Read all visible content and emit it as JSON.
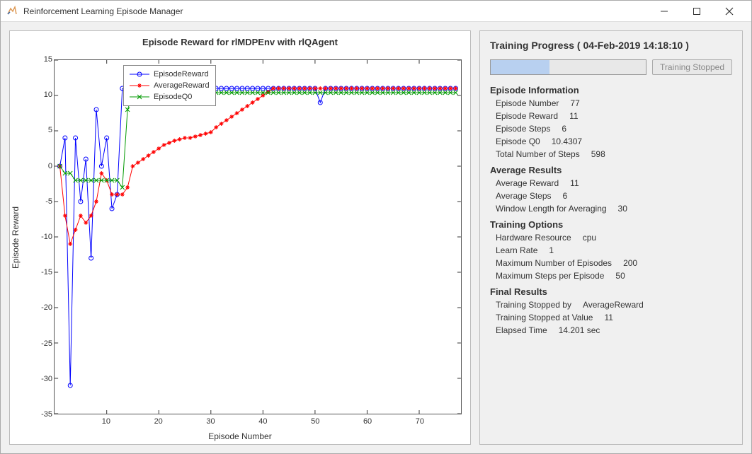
{
  "window": {
    "title": "Reinforcement Learning Episode Manager"
  },
  "plot": {
    "title": "Episode Reward for rlMDPEnv with rlQAgent",
    "xlabel": "Episode Number",
    "ylabel": "Episode Reward",
    "legend": {
      "s1": "EpisodeReward",
      "s2": "AverageReward",
      "s3": "EpisodeQ0"
    }
  },
  "side": {
    "title": "Training Progress ( 04-Feb-2019 14:18:10 )",
    "button": "Training Stopped",
    "sections": {
      "ep_info": "Episode Information",
      "avg": "Average Results",
      "opts": "Training Options",
      "final": "Final Results"
    },
    "ep": {
      "num_k": "Episode Number",
      "num_v": "77",
      "rew_k": "Episode Reward",
      "rew_v": "11",
      "steps_k": "Episode Steps",
      "steps_v": "6",
      "q0_k": "Episode Q0",
      "q0_v": "10.4307",
      "total_k": "Total Number of Steps",
      "total_v": "598"
    },
    "avg_r": {
      "rew_k": "Average Reward",
      "rew_v": "11",
      "steps_k": "Average Steps",
      "steps_v": "6",
      "win_k": "Window Length for Averaging",
      "win_v": "30"
    },
    "opts": {
      "hw_k": "Hardware Resource",
      "hw_v": "cpu",
      "lr_k": "Learn Rate",
      "lr_v": "1",
      "maxep_k": "Maximum Number of Episodes",
      "maxep_v": "200",
      "maxst_k": "Maximum Steps per Episode",
      "maxst_v": "50"
    },
    "final": {
      "by_k": "Training Stopped by",
      "by_v": "AverageReward",
      "val_k": "Training Stopped at Value",
      "val_v": "11",
      "time_k": "Elapsed Time",
      "time_v": "14.201 sec"
    }
  },
  "chart_data": {
    "type": "line",
    "xlabel": "Episode Number",
    "ylabel": "Episode Reward",
    "xlim": [
      0,
      78
    ],
    "ylim": [
      -35,
      15
    ],
    "xticks": [
      10,
      20,
      30,
      40,
      50,
      60,
      70
    ],
    "yticks": [
      -35,
      -30,
      -25,
      -20,
      -15,
      -10,
      -5,
      0,
      5,
      10,
      15
    ],
    "x": [
      1,
      2,
      3,
      4,
      5,
      6,
      7,
      8,
      9,
      10,
      11,
      12,
      13,
      14,
      15,
      16,
      17,
      18,
      19,
      20,
      21,
      22,
      23,
      24,
      25,
      26,
      27,
      28,
      29,
      30,
      31,
      32,
      33,
      34,
      35,
      36,
      37,
      38,
      39,
      40,
      41,
      42,
      43,
      44,
      45,
      46,
      47,
      48,
      49,
      50,
      51,
      52,
      53,
      54,
      55,
      56,
      57,
      58,
      59,
      60,
      61,
      62,
      63,
      64,
      65,
      66,
      67,
      68,
      69,
      70,
      71,
      72,
      73,
      74,
      75,
      76,
      77
    ],
    "series": [
      {
        "name": "EpisodeReward",
        "color": "#0000ff",
        "marker": "o",
        "values": [
          0,
          4,
          -31,
          4,
          -5,
          1,
          -13,
          8,
          0,
          4,
          -6,
          -4,
          11,
          11,
          11,
          11,
          11,
          11,
          11,
          11,
          11,
          11,
          11,
          11,
          11,
          9,
          11,
          11,
          11,
          11,
          11,
          11,
          11,
          11,
          11,
          11,
          11,
          11,
          11,
          11,
          11,
          11,
          11,
          11,
          11,
          11,
          11,
          11,
          11,
          11,
          9,
          11,
          11,
          11,
          11,
          11,
          11,
          11,
          11,
          11,
          11,
          11,
          11,
          11,
          11,
          11,
          11,
          11,
          11,
          11,
          11,
          11,
          11,
          11,
          11,
          11,
          11
        ]
      },
      {
        "name": "AverageReward",
        "color": "#ff0000",
        "marker": "*",
        "values": [
          0,
          -7,
          -11,
          -9,
          -7,
          -8,
          -7,
          -5,
          -1,
          -2,
          -4,
          -4,
          -4,
          -3,
          0,
          0.5,
          1,
          1.5,
          2,
          2.5,
          3,
          3.3,
          3.6,
          3.8,
          4,
          4,
          4.2,
          4.4,
          4.6,
          4.8,
          5.5,
          6,
          6.5,
          7,
          7.5,
          8,
          8.5,
          9,
          9.5,
          10,
          10.5,
          11,
          11,
          11,
          11,
          11,
          11,
          11,
          11,
          11,
          11,
          11,
          11,
          11,
          11,
          11,
          11,
          11,
          11,
          11,
          11,
          11,
          11,
          11,
          11,
          11,
          11,
          11,
          11,
          11,
          11,
          11,
          11,
          11,
          11,
          11,
          11
        ]
      },
      {
        "name": "EpisodeQ0",
        "color": "#009900",
        "marker": "x",
        "values": [
          0,
          -1,
          -1,
          -2,
          -2,
          -2,
          -2,
          -2,
          -2,
          -2,
          -2,
          -2,
          -3,
          8,
          10,
          10.4,
          10.4,
          10.4,
          10.4,
          10.4,
          10.4,
          10.4,
          10.4,
          10.4,
          10.4,
          10.4,
          10.4,
          10.4,
          10.4,
          10.4,
          10.4,
          10.4,
          10.4,
          10.4,
          10.4,
          10.4,
          10.4,
          10.4,
          10.4,
          10.4,
          10.4,
          10.4,
          10.4,
          10.4,
          10.4,
          10.4,
          10.4,
          10.4,
          10.4,
          10.4,
          10.4,
          10.4,
          10.4,
          10.4,
          10.4,
          10.4,
          10.4,
          10.4,
          10.4,
          10.4,
          10.4,
          10.4,
          10.4,
          10.4,
          10.4,
          10.4,
          10.4,
          10.4,
          10.4,
          10.4,
          10.4,
          10.4,
          10.4,
          10.4,
          10.4,
          10.4,
          10.4
        ]
      }
    ]
  }
}
